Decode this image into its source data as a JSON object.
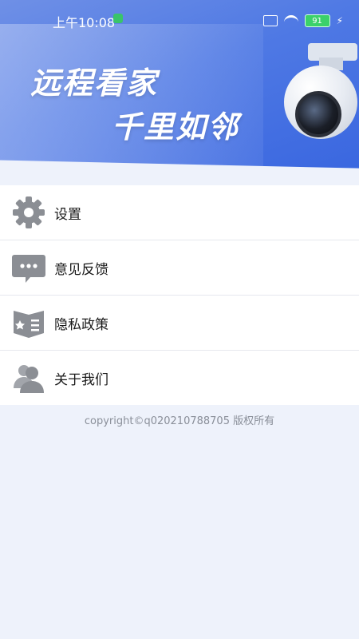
{
  "status_bar": {
    "time": "上午10:08",
    "battery": "91"
  },
  "banner": {
    "slogan_line1": "远程看家",
    "slogan_line2": "千里如邻"
  },
  "menu": {
    "items": [
      {
        "label": "设置",
        "icon": "gear-icon"
      },
      {
        "label": "意见反馈",
        "icon": "chat-bubble-icon"
      },
      {
        "label": "隐私政策",
        "icon": "shield-list-icon"
      },
      {
        "label": "关于我们",
        "icon": "users-icon"
      }
    ]
  },
  "footer": {
    "copyright": "copyright©q020210788705 版权所有"
  },
  "colors": {
    "banner_blue": "#4f79e4",
    "icon_gray": "#8b8e94",
    "background": "#eef2fb"
  }
}
